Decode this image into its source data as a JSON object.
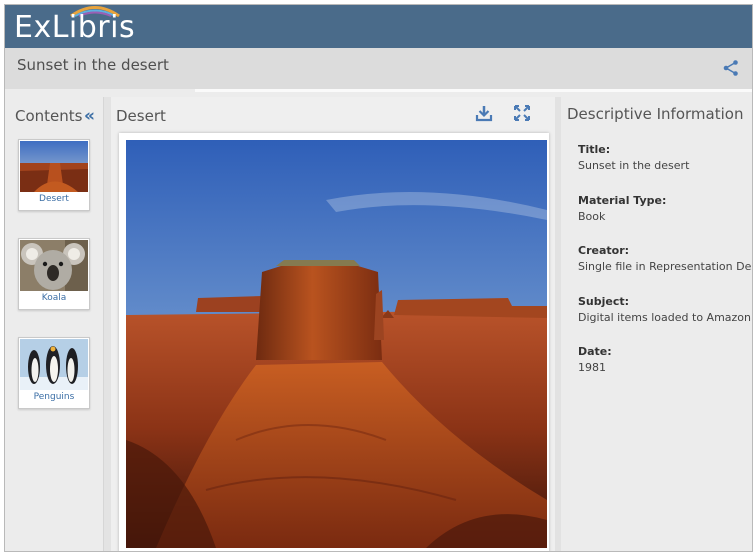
{
  "header": {
    "logo_text": "ExLibris",
    "brand_color": "#4a6b8a",
    "doc_title": "Sunset in the desert",
    "share_icon": "share-icon"
  },
  "sidebar": {
    "title": "Contents",
    "collapse_glyph": "«",
    "items": [
      {
        "label": "Desert",
        "icon": "desert-thumbnail"
      },
      {
        "label": "Koala",
        "icon": "koala-thumbnail"
      },
      {
        "label": "Penguins",
        "icon": "penguins-thumbnail"
      }
    ]
  },
  "viewer": {
    "title": "Desert",
    "download_icon": "download-icon",
    "fullscreen_icon": "fullscreen-icon"
  },
  "info": {
    "title": "Descriptive Information",
    "fields": [
      {
        "label": "Title:",
        "value": "Sunset in the desert"
      },
      {
        "label": "Material Type:",
        "value": "Book"
      },
      {
        "label": "Creator:",
        "value": "Single file in Representation Desert"
      },
      {
        "label": "Subject:",
        "value": "Digital items loaded to Amazon"
      },
      {
        "label": "Date:",
        "value": "1981"
      }
    ]
  },
  "colors": {
    "accent": "#3b6ea5",
    "panel_bg": "#ececec"
  }
}
